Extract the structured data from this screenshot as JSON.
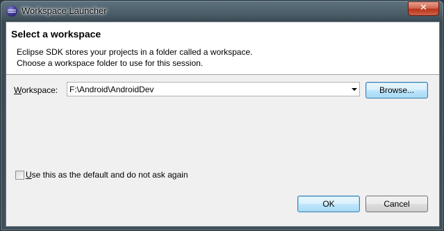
{
  "window": {
    "title": "Workspace Launcher",
    "close_symbol": "✕"
  },
  "header": {
    "title": "Select a workspace",
    "desc_line1": "Eclipse SDK stores your projects in a folder called a workspace.",
    "desc_line2": "Choose a workspace folder to use for this session."
  },
  "workspace": {
    "label_mnemonic": "W",
    "label_rest": "orkspace:",
    "value": "F:\\Android\\AndroidDev",
    "browse_label": "Browse..."
  },
  "default_option": {
    "mnemonic": "U",
    "label_rest": "se this as the default and do not ask again",
    "checked": false
  },
  "buttons": {
    "ok_label": "OK",
    "cancel_label": "Cancel"
  },
  "icons": {
    "app": "eclipse-icon",
    "close": "close-icon",
    "dropdown": "chevron-down-icon"
  }
}
